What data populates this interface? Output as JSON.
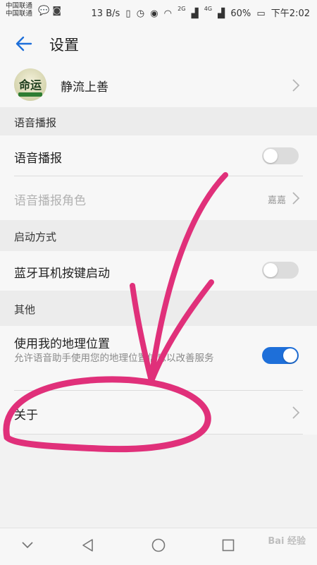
{
  "status_bar": {
    "carrier_1": "中国联通",
    "carrier_2": "中国联通",
    "speed": "13 B/s",
    "net_tag_1": "2G",
    "net_tag_2": "4G",
    "battery": "60%",
    "time": "下午2:02"
  },
  "header": {
    "title": "设置"
  },
  "profile": {
    "name": "静流上善",
    "avatar_text": "命运"
  },
  "sections": {
    "voice_broadcast": "语音播报",
    "startup": "启动方式",
    "other": "其他"
  },
  "items": {
    "voice_broadcast": {
      "label": "语音播报",
      "enabled": false
    },
    "voice_role": {
      "label": "语音播报角色",
      "value": "嘉嘉"
    },
    "bluetooth_start": {
      "label": "蓝牙耳机按键启动",
      "enabled": false
    },
    "location": {
      "label": "使用我的地理位置",
      "desc": "允许语音助手使用您的地理位置信息以改善服务",
      "enabled": true
    },
    "about": {
      "label": "关于"
    }
  },
  "watermark": "Bai 经验",
  "colors": {
    "accent": "#1e6fd9",
    "annotation": "#e0307a"
  }
}
